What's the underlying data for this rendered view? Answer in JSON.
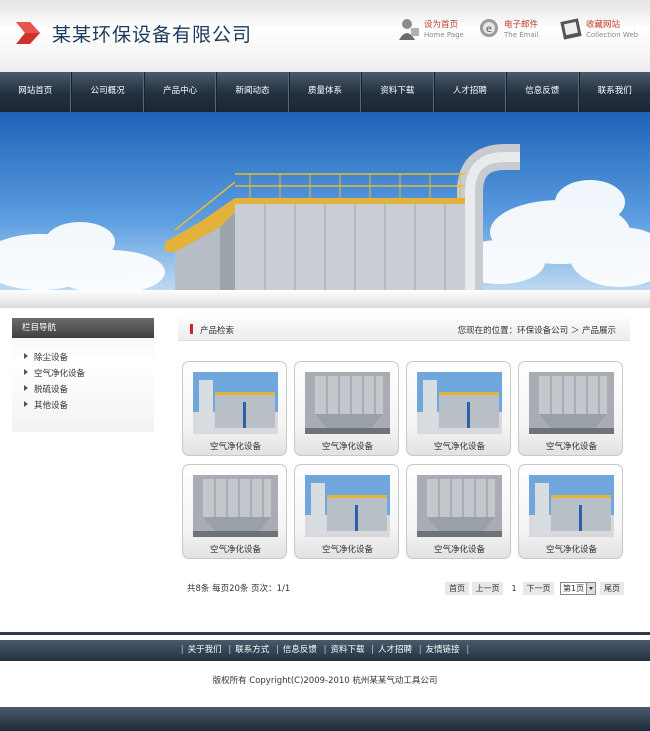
{
  "header": {
    "site_title": "某某环保设备有限公司",
    "links": [
      {
        "cn": "设为首页",
        "en": "Home Page",
        "icon": "home-page-icon"
      },
      {
        "cn": "电子邮件",
        "en": "The Email",
        "icon": "email-icon"
      },
      {
        "cn": "收藏网站",
        "en": "Collection Web",
        "icon": "bookmark-icon"
      }
    ]
  },
  "nav": {
    "items": [
      "网站首页",
      "公司概况",
      "产品中心",
      "新闻动态",
      "质量体系",
      "资料下载",
      "人才招聘",
      "信息反馈",
      "联系我们"
    ]
  },
  "sidebar": {
    "title": "栏目导航",
    "items": [
      "除尘设备",
      "空气净化设备",
      "脱硫设备",
      "其他设备"
    ]
  },
  "content": {
    "title": "产品检索",
    "breadcrumb": "您现在的位置：环保设备公司 ＞ 产品展示"
  },
  "products": [
    {
      "name": "空气净化设备"
    },
    {
      "name": "空气净化设备"
    },
    {
      "name": "空气净化设备"
    },
    {
      "name": "空气净化设备"
    },
    {
      "name": "空气净化设备"
    },
    {
      "name": "空气净化设备"
    },
    {
      "name": "空气净化设备"
    },
    {
      "name": "空气净化设备"
    }
  ],
  "pager": {
    "info": "共8条  每页20条  页次：1/1",
    "first": "首页",
    "prev": "上一页",
    "current": "1",
    "next": "下一页",
    "select": "第1页",
    "last": "尾页"
  },
  "footer": {
    "links": [
      "关于我们",
      "联系方式",
      "信息反馈",
      "资料下载",
      "人才招聘",
      "友情链接"
    ],
    "copyright": "版权所有  Copyright(C)2009-2010 杭州某某气动工具公司"
  },
  "colors": {
    "nav_bg": "#22303f",
    "title": "#1b3a5e",
    "accent_red": "#c62828"
  }
}
